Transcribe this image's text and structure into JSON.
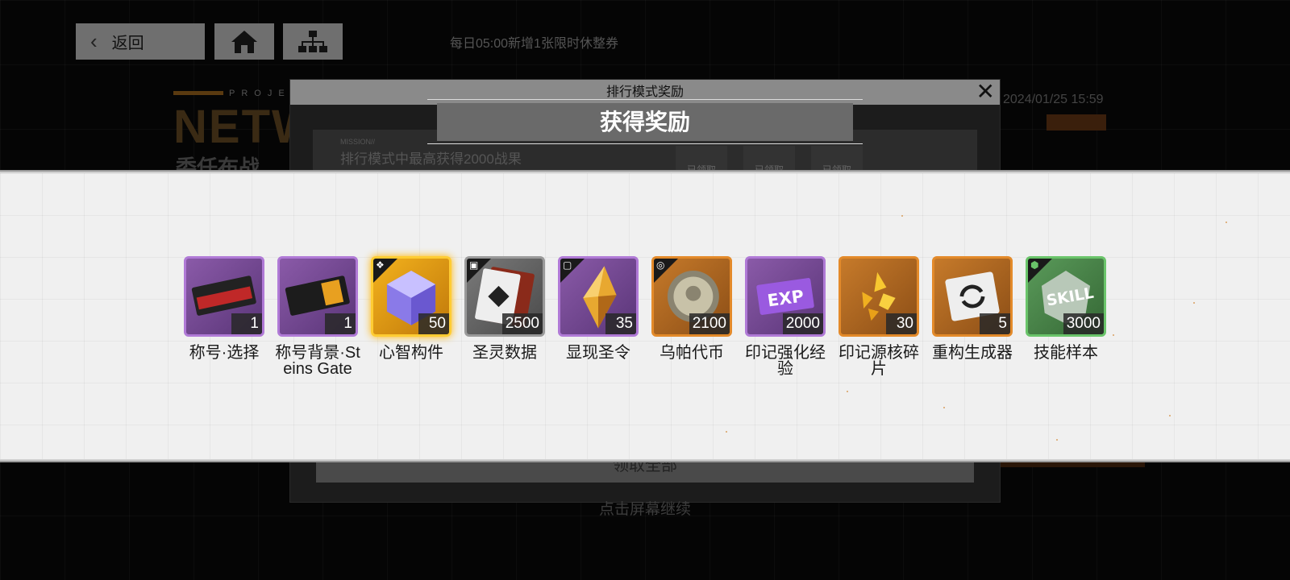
{
  "nav": {
    "back_label": "返回",
    "notice": "每日05:00新增1张限时休整券"
  },
  "background": {
    "project_text": "PROJE",
    "title": "NETW",
    "subtitle": "委任布战",
    "date": "2024/01/25 15:59"
  },
  "dialog": {
    "header": "排行模式奖励",
    "mission_tag": "MISSION//",
    "mission_text": "排行模式中最高获得2000战果",
    "claimed_labels": [
      "已领取",
      "已领取",
      "已领取"
    ],
    "claim_all": "领取全部"
  },
  "reward": {
    "title": "获得奖励",
    "continue": "点击屏幕继续",
    "items": [
      {
        "name": "称号·选择",
        "qty": "1",
        "rarity": "purple"
      },
      {
        "name": "称号背景·Steins Gate",
        "qty": "1",
        "rarity": "purple"
      },
      {
        "name": "心智构件",
        "qty": "50",
        "rarity": "gold"
      },
      {
        "name": "圣灵数据",
        "qty": "2500",
        "rarity": "grey"
      },
      {
        "name": "显现圣令",
        "qty": "35",
        "rarity": "purple"
      },
      {
        "name": "乌帕代币",
        "qty": "2100",
        "rarity": "orange"
      },
      {
        "name": "印记强化经验",
        "qty": "2000",
        "rarity": "purple"
      },
      {
        "name": "印记源核碎片",
        "qty": "30",
        "rarity": "orange"
      },
      {
        "name": "重构生成器",
        "qty": "5",
        "rarity": "orange"
      },
      {
        "name": "技能样本",
        "qty": "3000",
        "rarity": "green"
      }
    ]
  },
  "icons": {
    "back": "chevron-left-icon",
    "home": "home-icon",
    "map": "hierarchy-icon",
    "close": "close-icon"
  }
}
